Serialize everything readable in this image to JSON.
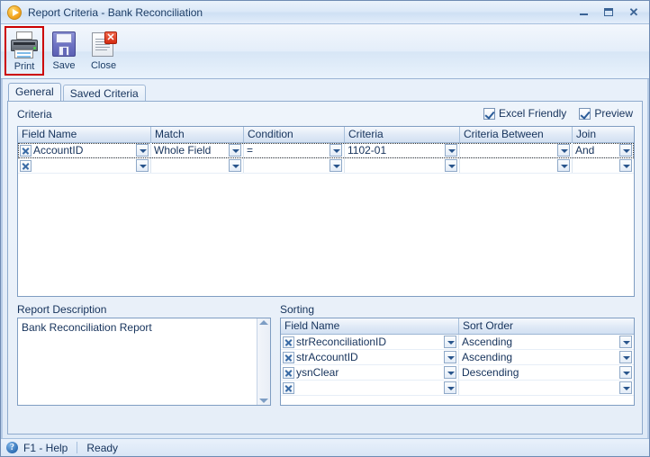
{
  "window": {
    "title": "Report Criteria - Bank Reconciliation",
    "icon": "play-circle-icon",
    "buttons": {
      "minimize": "minimize-icon",
      "maximize": "maximize-icon",
      "close": "close-icon"
    }
  },
  "toolbar": {
    "items": [
      {
        "label": "Print",
        "icon": "printer-icon",
        "highlighted": true
      },
      {
        "label": "Save",
        "icon": "floppy-disk-icon",
        "highlighted": false
      },
      {
        "label": "Close",
        "icon": "document-close-icon",
        "highlighted": false
      }
    ]
  },
  "tabs": [
    {
      "label": "General",
      "active": true
    },
    {
      "label": "Saved Criteria",
      "active": false
    }
  ],
  "criteria": {
    "section_label": "Criteria",
    "options": [
      {
        "label": "Excel Friendly",
        "checked": true
      },
      {
        "label": "Preview",
        "checked": true
      }
    ],
    "columns": [
      "Field Name",
      "Match",
      "Condition",
      "Criteria",
      "Criteria Between",
      "Join"
    ],
    "rows": [
      {
        "selected": true,
        "field_name": "AccountID",
        "match": "Whole Field",
        "condition": "=",
        "criteria": "1102-01",
        "criteria_between": "",
        "join": "And"
      },
      {
        "selected": false,
        "field_name": "",
        "match": "",
        "condition": "",
        "criteria": "",
        "criteria_between": "",
        "join": ""
      }
    ]
  },
  "report_description": {
    "title": "Report Description",
    "text": "Bank Reconciliation Report",
    "scroll_up_icon": "scroll-up-arrow-icon",
    "scroll_down_icon": "scroll-down-arrow-icon"
  },
  "sorting": {
    "title": "Sorting",
    "columns": [
      "Field Name",
      "Sort Order"
    ],
    "rows": [
      {
        "field_name": "strReconciliationID",
        "sort_order": "Ascending"
      },
      {
        "field_name": "strAccountID",
        "sort_order": "Ascending"
      },
      {
        "field_name": "ysnClear",
        "sort_order": "Descending"
      },
      {
        "field_name": "",
        "sort_order": ""
      }
    ]
  },
  "statusbar": {
    "help_icon": "help-question-icon",
    "help_label": "F1 - Help",
    "status": "Ready"
  },
  "colors": {
    "accent": "#2b5c99",
    "highlight_border": "#cc0000",
    "frame": "#6f8bb3"
  }
}
